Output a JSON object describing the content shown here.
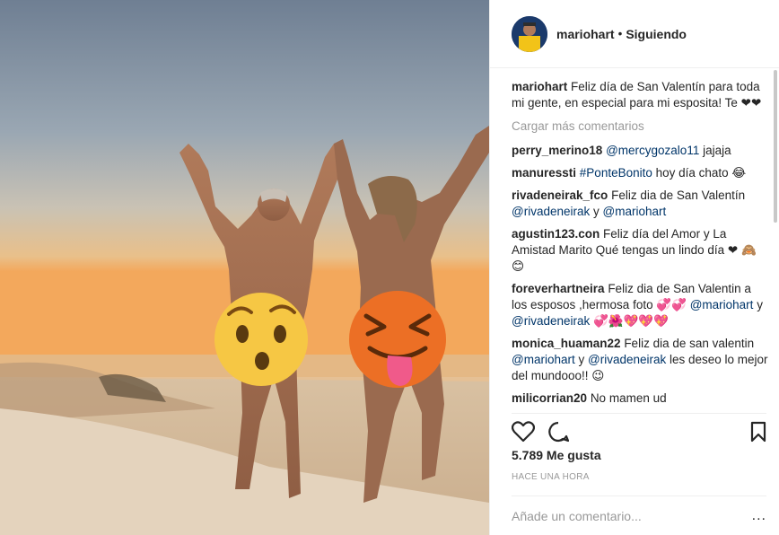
{
  "post": {
    "username": "mariohart",
    "separator": "•",
    "follow_status": "Siguiendo",
    "caption_user": "mariohart",
    "caption_text": "Feliz día de San Valentín para toda mi gente, en especial para mi esposita! Te ❤❤",
    "load_more": "Cargar más comentarios",
    "comments": [
      {
        "user": "perry_merino18",
        "parts": [
          {
            "t": "link",
            "v": "@mercygozalo11"
          },
          {
            "t": "text",
            "v": " jajaja"
          }
        ]
      },
      {
        "user": "manuressti",
        "parts": [
          {
            "t": "link",
            "v": "#PonteBonito"
          },
          {
            "t": "text",
            "v": " hoy día chato 😂"
          }
        ]
      },
      {
        "user": "rivadeneirak_fco",
        "parts": [
          {
            "t": "text",
            "v": "Feliz dia de San Valentín "
          },
          {
            "t": "link",
            "v": "@rivadeneirak"
          },
          {
            "t": "text",
            "v": " y "
          },
          {
            "t": "link",
            "v": "@mariohart"
          }
        ]
      },
      {
        "user": "agustin123.con",
        "parts": [
          {
            "t": "text",
            "v": "Feliz día del Amor y La Amistad Marito Qué tengas un lindo día ❤ 🙈😊"
          }
        ]
      },
      {
        "user": "foreverhartneira",
        "parts": [
          {
            "t": "text",
            "v": "Feliz dia de San Valentin a los esposos ,hermosa foto 💞💞 "
          },
          {
            "t": "link",
            "v": "@mariohart"
          },
          {
            "t": "text",
            "v": " y "
          },
          {
            "t": "link",
            "v": "@rivadeneirak"
          },
          {
            "t": "text",
            "v": " 💞🌺💖💖💖"
          }
        ]
      },
      {
        "user": "monica_huaman22",
        "parts": [
          {
            "t": "text",
            "v": "Feliz dia de san valentin "
          },
          {
            "t": "link",
            "v": "@mariohart"
          },
          {
            "t": "text",
            "v": " y "
          },
          {
            "t": "link",
            "v": "@rivadeneirak"
          },
          {
            "t": "text",
            "v": " les deseo lo mejor del mundooo!! 😉"
          }
        ]
      },
      {
        "user": "milicorrian20",
        "parts": [
          {
            "t": "text",
            "v": "No mamen ud"
          }
        ]
      }
    ],
    "likes": "5.789 Me gusta",
    "time": "HACE UNA HORA",
    "add_comment_placeholder": "Añade un comentario...",
    "more_menu": "..."
  },
  "colors": {
    "link": "#003569",
    "muted": "#999999",
    "border": "#efefef"
  },
  "icons": [
    "heart-icon",
    "comment-icon",
    "bookmark-icon",
    "avatar"
  ]
}
